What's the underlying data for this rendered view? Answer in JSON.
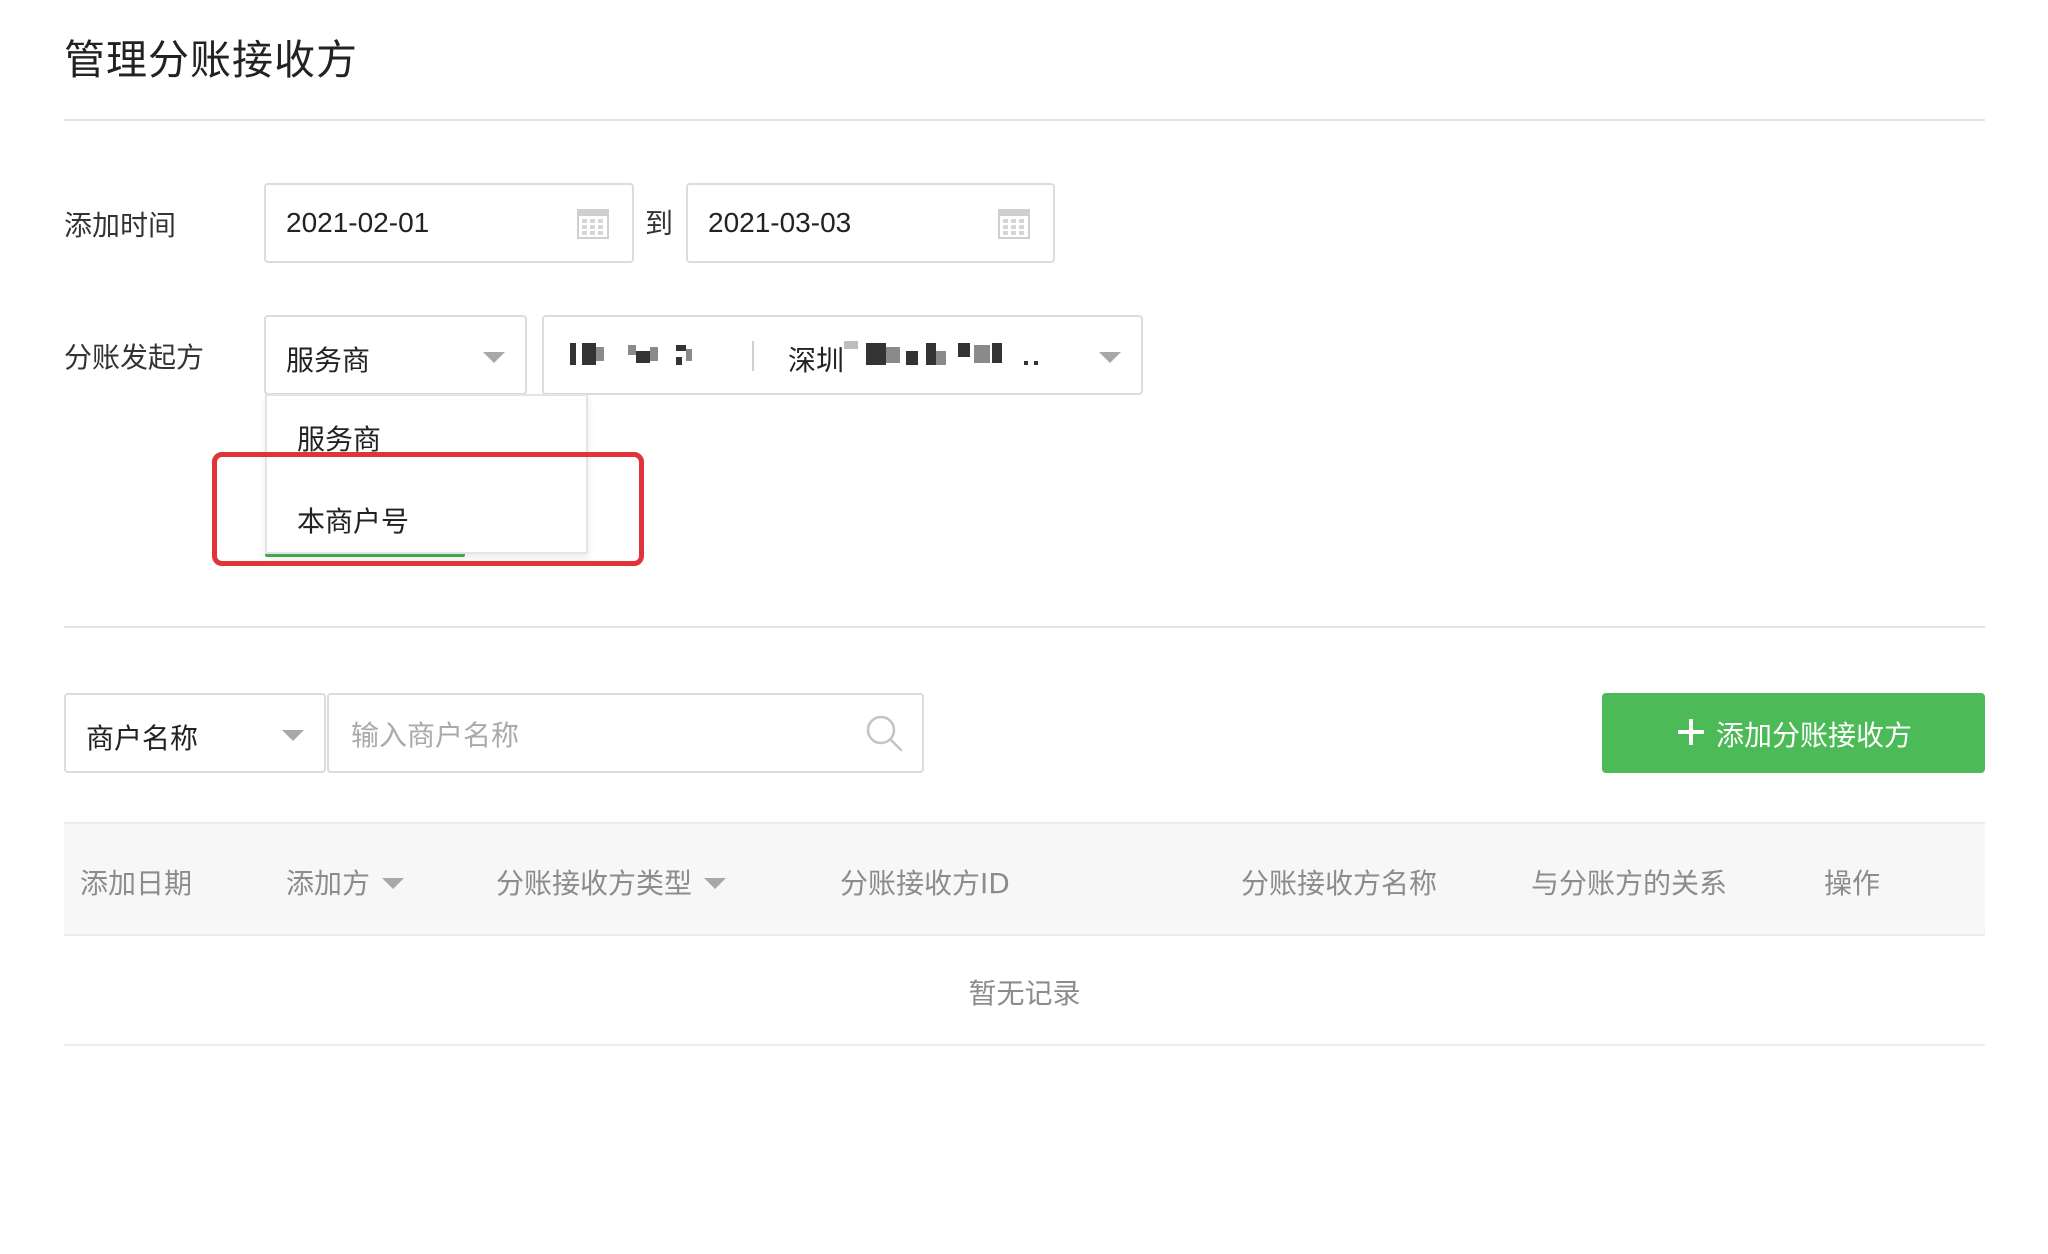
{
  "page": {
    "title": "管理分账接收方"
  },
  "filters": {
    "time_label": "添加时间",
    "start_date": "2021-02-01",
    "to_label": "到",
    "end_date": "2021-03-03",
    "initiator_label": "分账发起方",
    "role_selected": "服务商",
    "merchant_selected": "深圳",
    "role_options": [
      "服务商",
      "本商户号"
    ]
  },
  "search": {
    "field_selected": "商户名称",
    "placeholder": "输入商户名称"
  },
  "add_button": {
    "label": "添加分账接收方"
  },
  "table": {
    "columns": [
      "添加日期",
      "添加方",
      "分账接收方类型",
      "分账接收方ID",
      "分账接收方名称",
      "与分账方的关系",
      "操作"
    ],
    "empty_text": "暂无记录"
  },
  "colors": {
    "accent_green": "#4cba57",
    "highlight_red": "#e0343a"
  },
  "icons": [
    "calendar-icon",
    "chevron-down-icon",
    "search-icon",
    "plus-icon"
  ]
}
